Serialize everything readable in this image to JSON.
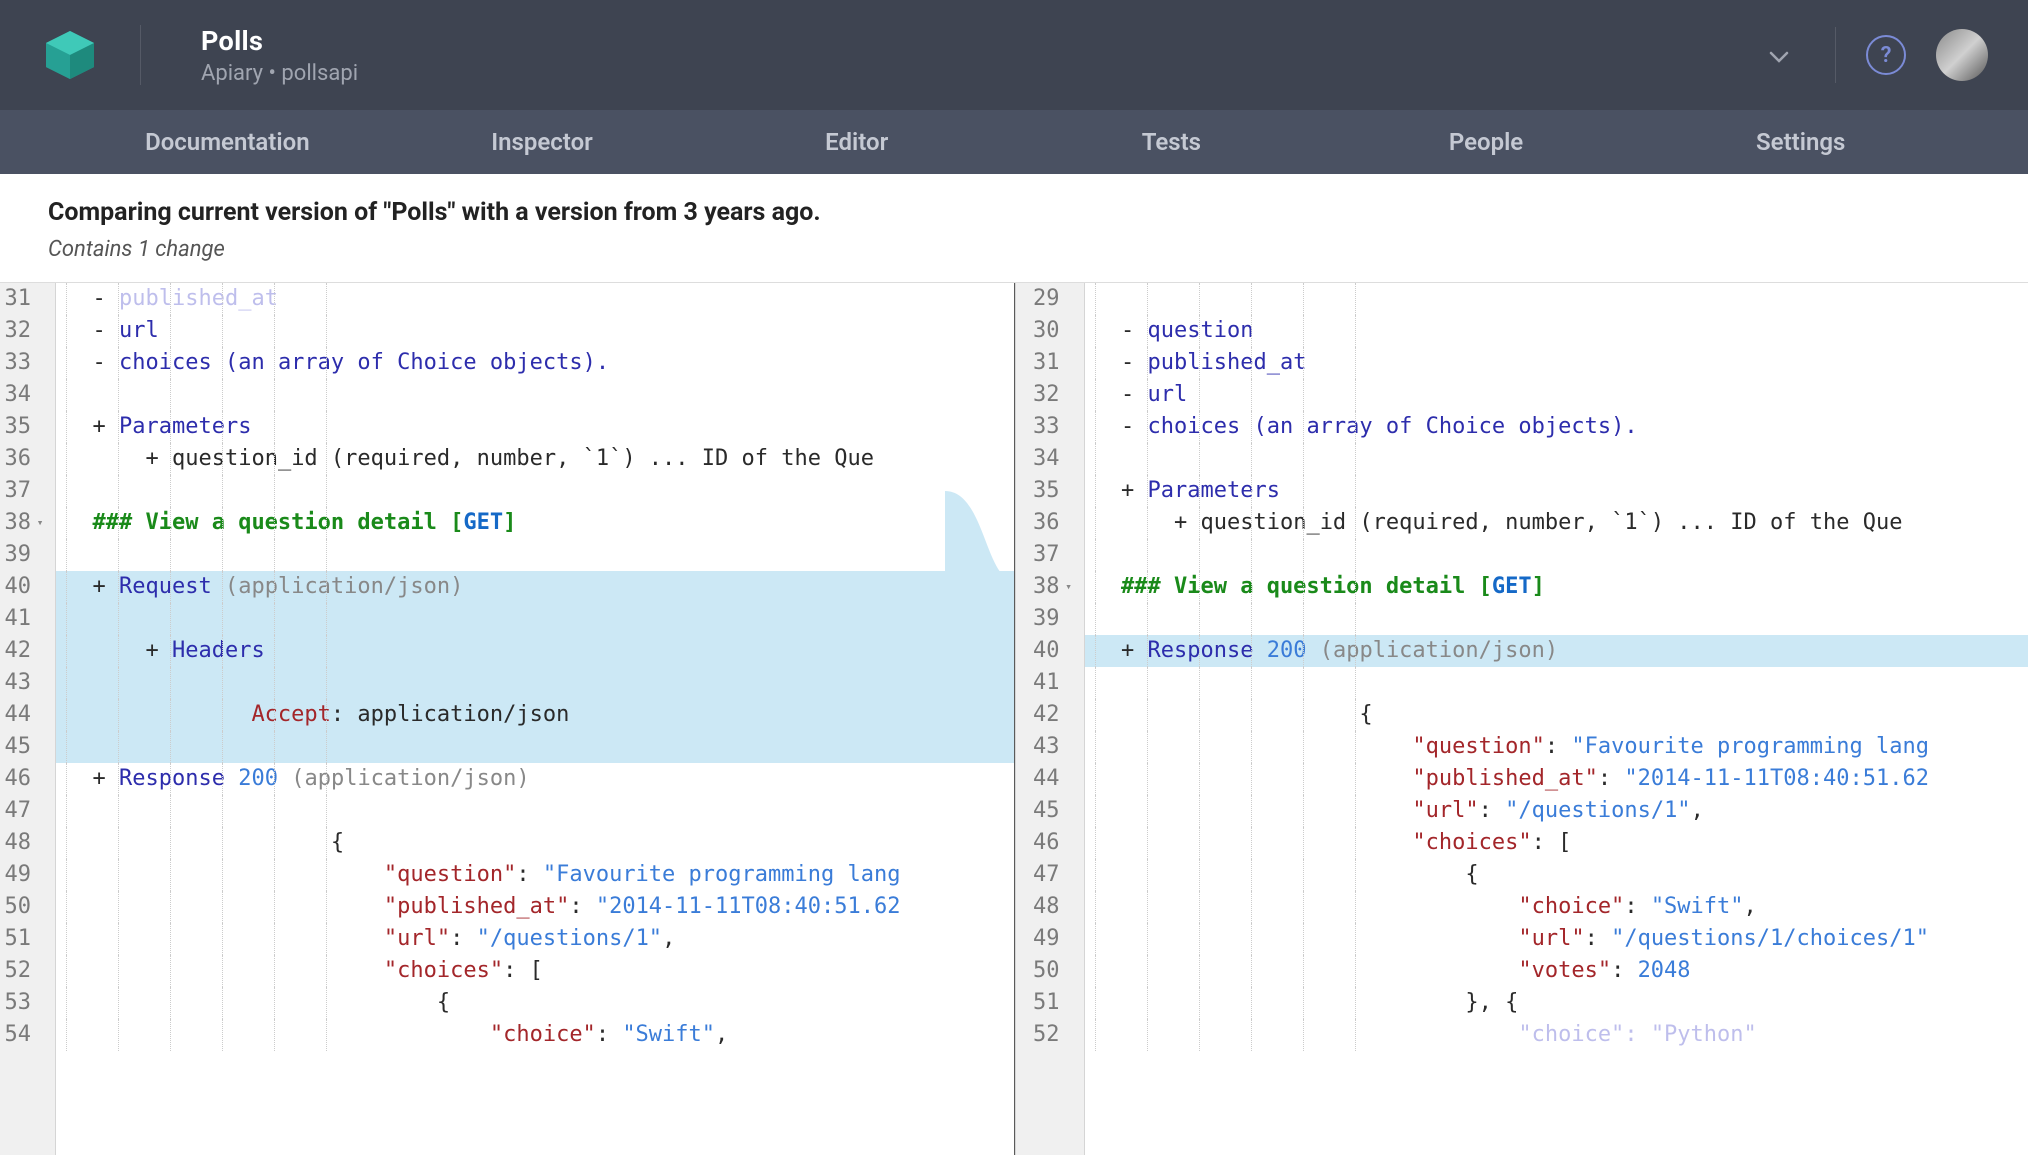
{
  "header": {
    "title": "Polls",
    "subtitle": "Apiary • pollsapi"
  },
  "nav": {
    "tabs": [
      "Documentation",
      "Inspector",
      "Editor",
      "Tests",
      "People",
      "Settings"
    ]
  },
  "compare": {
    "title": "Comparing current version of \"Polls\" with a version from 3 years ago.",
    "subtitle": "Contains 1 change"
  },
  "left": {
    "start": 31,
    "lines": [
      {
        "n": 31,
        "hl": false,
        "seg": [
          [
            "  ",
            "t-dark"
          ],
          [
            "- ",
            "t-dark"
          ],
          [
            "published_at",
            "t-faded"
          ]
        ]
      },
      {
        "n": 32,
        "hl": false,
        "seg": [
          [
            "  ",
            "t-dark"
          ],
          [
            "- ",
            "t-dark"
          ],
          [
            "url",
            "t-key"
          ]
        ]
      },
      {
        "n": 33,
        "hl": false,
        "seg": [
          [
            "  ",
            "t-dark"
          ],
          [
            "- ",
            "t-dark"
          ],
          [
            "choices (an array of Choice objects).",
            "t-key"
          ]
        ]
      },
      {
        "n": 34,
        "hl": false,
        "seg": [
          [
            "",
            ""
          ]
        ]
      },
      {
        "n": 35,
        "hl": false,
        "seg": [
          [
            "  ",
            "t-dark"
          ],
          [
            "+ ",
            "t-dark"
          ],
          [
            "Parameters",
            "t-key"
          ]
        ]
      },
      {
        "n": 36,
        "hl": false,
        "seg": [
          [
            "      ",
            "t-dark"
          ],
          [
            "+ ",
            "t-dark"
          ],
          [
            "question_id (required, number, `1`) ... ID of the Que",
            "t-dark"
          ]
        ]
      },
      {
        "n": 37,
        "hl": false,
        "seg": [
          [
            "",
            ""
          ]
        ]
      },
      {
        "n": 38,
        "fold": true,
        "hl": false,
        "seg": [
          [
            "  ",
            ""
          ],
          [
            "### View a question detail ",
            "t-head"
          ],
          [
            "[",
            "t-head"
          ],
          [
            "GET",
            "t-meth"
          ],
          [
            "]",
            "t-head"
          ]
        ]
      },
      {
        "n": 39,
        "hl": false,
        "seg": [
          [
            "",
            ""
          ]
        ]
      },
      {
        "n": 40,
        "hl": true,
        "seg": [
          [
            "  ",
            "t-dark"
          ],
          [
            "+ ",
            "t-dark"
          ],
          [
            "Request ",
            "t-key"
          ],
          [
            "(application/json)",
            "t-gray"
          ]
        ]
      },
      {
        "n": 41,
        "hl": true,
        "seg": [
          [
            "",
            ""
          ]
        ]
      },
      {
        "n": 42,
        "hl": true,
        "seg": [
          [
            "      ",
            "t-dark"
          ],
          [
            "+ ",
            "t-dark"
          ],
          [
            "Headers",
            "t-key"
          ]
        ]
      },
      {
        "n": 43,
        "hl": true,
        "seg": [
          [
            "",
            ""
          ]
        ]
      },
      {
        "n": 44,
        "hl": true,
        "seg": [
          [
            "              ",
            ""
          ],
          [
            "Accept",
            "t-attr"
          ],
          [
            ": ",
            "t-dark"
          ],
          [
            "application/json",
            "t-dark"
          ]
        ]
      },
      {
        "n": 45,
        "hl": true,
        "seg": [
          [
            "",
            ""
          ]
        ]
      },
      {
        "n": 46,
        "hl": false,
        "seg": [
          [
            "  ",
            "t-dark"
          ],
          [
            "+ ",
            "t-dark"
          ],
          [
            "Response ",
            "t-key"
          ],
          [
            "200",
            "t-num"
          ],
          [
            " (application/json)",
            "t-gray"
          ]
        ]
      },
      {
        "n": 47,
        "hl": false,
        "seg": [
          [
            "",
            ""
          ]
        ]
      },
      {
        "n": 48,
        "hl": false,
        "seg": [
          [
            "                    ",
            ""
          ],
          [
            "{",
            "t-dark"
          ]
        ]
      },
      {
        "n": 49,
        "hl": false,
        "seg": [
          [
            "                        ",
            ""
          ],
          [
            "\"question\"",
            "t-prop"
          ],
          [
            ": ",
            "t-dark"
          ],
          [
            "\"Favourite programming lang",
            "t-str"
          ]
        ]
      },
      {
        "n": 50,
        "hl": false,
        "seg": [
          [
            "                        ",
            ""
          ],
          [
            "\"published_at\"",
            "t-prop"
          ],
          [
            ": ",
            "t-dark"
          ],
          [
            "\"2014-11-11T08:40:51.62",
            "t-str"
          ]
        ]
      },
      {
        "n": 51,
        "hl": false,
        "seg": [
          [
            "                        ",
            ""
          ],
          [
            "\"url\"",
            "t-prop"
          ],
          [
            ": ",
            "t-dark"
          ],
          [
            "\"/questions/1\"",
            "t-str"
          ],
          [
            ",",
            "t-dark"
          ]
        ]
      },
      {
        "n": 52,
        "hl": false,
        "seg": [
          [
            "                        ",
            ""
          ],
          [
            "\"choices\"",
            "t-prop"
          ],
          [
            ": [",
            "t-dark"
          ]
        ]
      },
      {
        "n": 53,
        "hl": false,
        "seg": [
          [
            "                            ",
            ""
          ],
          [
            "{",
            "t-dark"
          ]
        ]
      },
      {
        "n": 54,
        "hl": false,
        "seg": [
          [
            "                                ",
            ""
          ],
          [
            "\"choice\"",
            "t-prop"
          ],
          [
            ": ",
            "t-dark"
          ],
          [
            "\"Swift\"",
            "t-str"
          ],
          [
            ",",
            "t-dark"
          ]
        ]
      }
    ]
  },
  "right": {
    "lines": [
      {
        "n": 29,
        "hl": false,
        "seg": [
          [
            "",
            ""
          ]
        ]
      },
      {
        "n": 30,
        "hl": false,
        "seg": [
          [
            "  ",
            "t-dark"
          ],
          [
            "- ",
            "t-dark"
          ],
          [
            "question",
            "t-key"
          ]
        ]
      },
      {
        "n": 31,
        "hl": false,
        "seg": [
          [
            "  ",
            "t-dark"
          ],
          [
            "- ",
            "t-dark"
          ],
          [
            "published_at",
            "t-key"
          ]
        ]
      },
      {
        "n": 32,
        "hl": false,
        "seg": [
          [
            "  ",
            "t-dark"
          ],
          [
            "- ",
            "t-dark"
          ],
          [
            "url",
            "t-key"
          ]
        ]
      },
      {
        "n": 33,
        "hl": false,
        "seg": [
          [
            "  ",
            "t-dark"
          ],
          [
            "- ",
            "t-dark"
          ],
          [
            "choices (an array of Choice objects).",
            "t-key"
          ]
        ]
      },
      {
        "n": 34,
        "hl": false,
        "seg": [
          [
            "",
            ""
          ]
        ]
      },
      {
        "n": 35,
        "hl": false,
        "seg": [
          [
            "  ",
            "t-dark"
          ],
          [
            "+ ",
            "t-dark"
          ],
          [
            "Parameters",
            "t-key"
          ]
        ]
      },
      {
        "n": 36,
        "hl": false,
        "seg": [
          [
            "      ",
            "t-dark"
          ],
          [
            "+ ",
            "t-dark"
          ],
          [
            "question_id (required, number, `1`) ... ID of the Que",
            "t-dark"
          ]
        ]
      },
      {
        "n": 37,
        "hl": false,
        "seg": [
          [
            "",
            ""
          ]
        ]
      },
      {
        "n": 38,
        "fold": true,
        "hl": false,
        "seg": [
          [
            "  ",
            ""
          ],
          [
            "### View a question detail ",
            "t-head"
          ],
          [
            "[",
            "t-head"
          ],
          [
            "GET",
            "t-meth"
          ],
          [
            "]",
            "t-head"
          ]
        ]
      },
      {
        "n": 39,
        "hl": false,
        "seg": [
          [
            "",
            ""
          ]
        ]
      },
      {
        "n": 40,
        "hl": true,
        "seg": [
          [
            "  ",
            "t-dark"
          ],
          [
            "+ ",
            "t-dark"
          ],
          [
            "Response ",
            "t-key"
          ],
          [
            "200",
            "t-num"
          ],
          [
            " (application/json)",
            "t-gray"
          ]
        ]
      },
      {
        "n": 41,
        "hl": false,
        "seg": [
          [
            "",
            ""
          ]
        ]
      },
      {
        "n": 42,
        "hl": false,
        "seg": [
          [
            "                    ",
            ""
          ],
          [
            "{",
            "t-dark"
          ]
        ]
      },
      {
        "n": 43,
        "hl": false,
        "seg": [
          [
            "                        ",
            ""
          ],
          [
            "\"question\"",
            "t-prop"
          ],
          [
            ": ",
            "t-dark"
          ],
          [
            "\"Favourite programming lang",
            "t-str"
          ]
        ]
      },
      {
        "n": 44,
        "hl": false,
        "seg": [
          [
            "                        ",
            ""
          ],
          [
            "\"published_at\"",
            "t-prop"
          ],
          [
            ": ",
            "t-dark"
          ],
          [
            "\"2014-11-11T08:40:51.62",
            "t-str"
          ]
        ]
      },
      {
        "n": 45,
        "hl": false,
        "seg": [
          [
            "                        ",
            ""
          ],
          [
            "\"url\"",
            "t-prop"
          ],
          [
            ": ",
            "t-dark"
          ],
          [
            "\"/questions/1\"",
            "t-str"
          ],
          [
            ",",
            "t-dark"
          ]
        ]
      },
      {
        "n": 46,
        "hl": false,
        "seg": [
          [
            "                        ",
            ""
          ],
          [
            "\"choices\"",
            "t-prop"
          ],
          [
            ": [",
            "t-dark"
          ]
        ]
      },
      {
        "n": 47,
        "hl": false,
        "seg": [
          [
            "                            ",
            ""
          ],
          [
            "{",
            "t-dark"
          ]
        ]
      },
      {
        "n": 48,
        "hl": false,
        "seg": [
          [
            "                                ",
            ""
          ],
          [
            "\"choice\"",
            "t-prop"
          ],
          [
            ": ",
            "t-dark"
          ],
          [
            "\"Swift\"",
            "t-str"
          ],
          [
            ",",
            "t-dark"
          ]
        ]
      },
      {
        "n": 49,
        "hl": false,
        "seg": [
          [
            "                                ",
            ""
          ],
          [
            "\"url\"",
            "t-prop"
          ],
          [
            ": ",
            "t-dark"
          ],
          [
            "\"/questions/1/choices/1\"",
            "t-str"
          ]
        ]
      },
      {
        "n": 50,
        "hl": false,
        "seg": [
          [
            "                                ",
            ""
          ],
          [
            "\"votes\"",
            "t-prop"
          ],
          [
            ": ",
            "t-dark"
          ],
          [
            "2048",
            "t-num"
          ]
        ]
      },
      {
        "n": 51,
        "hl": false,
        "seg": [
          [
            "                            ",
            ""
          ],
          [
            "}, {",
            "t-dark"
          ]
        ]
      },
      {
        "n": 52,
        "hl": false,
        "seg": [
          [
            "                                ",
            ""
          ],
          [
            "\"choice\"",
            "t-faded"
          ],
          [
            ": ",
            "t-faded"
          ],
          [
            "\"Python\"",
            "t-faded"
          ]
        ]
      }
    ]
  }
}
